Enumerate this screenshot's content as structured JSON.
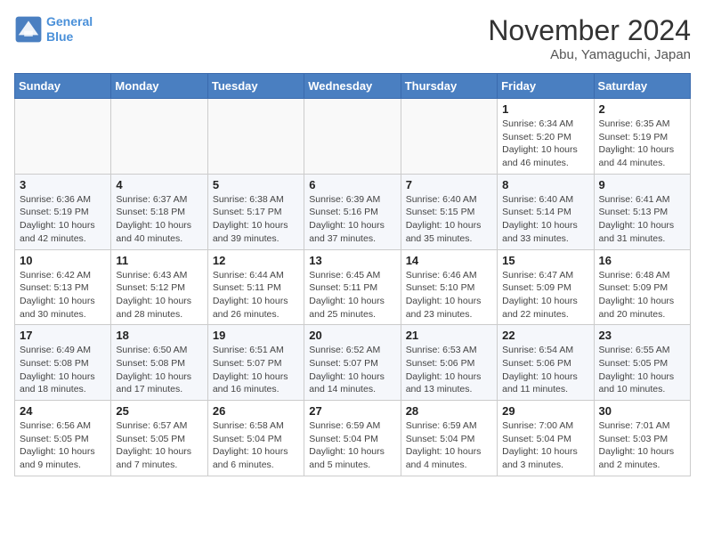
{
  "header": {
    "logo_line1": "General",
    "logo_line2": "Blue",
    "month": "November 2024",
    "location": "Abu, Yamaguchi, Japan"
  },
  "weekdays": [
    "Sunday",
    "Monday",
    "Tuesday",
    "Wednesday",
    "Thursday",
    "Friday",
    "Saturday"
  ],
  "weeks": [
    [
      {
        "day": "",
        "info": ""
      },
      {
        "day": "",
        "info": ""
      },
      {
        "day": "",
        "info": ""
      },
      {
        "day": "",
        "info": ""
      },
      {
        "day": "",
        "info": ""
      },
      {
        "day": "1",
        "info": "Sunrise: 6:34 AM\nSunset: 5:20 PM\nDaylight: 10 hours\nand 46 minutes."
      },
      {
        "day": "2",
        "info": "Sunrise: 6:35 AM\nSunset: 5:19 PM\nDaylight: 10 hours\nand 44 minutes."
      }
    ],
    [
      {
        "day": "3",
        "info": "Sunrise: 6:36 AM\nSunset: 5:19 PM\nDaylight: 10 hours\nand 42 minutes."
      },
      {
        "day": "4",
        "info": "Sunrise: 6:37 AM\nSunset: 5:18 PM\nDaylight: 10 hours\nand 40 minutes."
      },
      {
        "day": "5",
        "info": "Sunrise: 6:38 AM\nSunset: 5:17 PM\nDaylight: 10 hours\nand 39 minutes."
      },
      {
        "day": "6",
        "info": "Sunrise: 6:39 AM\nSunset: 5:16 PM\nDaylight: 10 hours\nand 37 minutes."
      },
      {
        "day": "7",
        "info": "Sunrise: 6:40 AM\nSunset: 5:15 PM\nDaylight: 10 hours\nand 35 minutes."
      },
      {
        "day": "8",
        "info": "Sunrise: 6:40 AM\nSunset: 5:14 PM\nDaylight: 10 hours\nand 33 minutes."
      },
      {
        "day": "9",
        "info": "Sunrise: 6:41 AM\nSunset: 5:13 PM\nDaylight: 10 hours\nand 31 minutes."
      }
    ],
    [
      {
        "day": "10",
        "info": "Sunrise: 6:42 AM\nSunset: 5:13 PM\nDaylight: 10 hours\nand 30 minutes."
      },
      {
        "day": "11",
        "info": "Sunrise: 6:43 AM\nSunset: 5:12 PM\nDaylight: 10 hours\nand 28 minutes."
      },
      {
        "day": "12",
        "info": "Sunrise: 6:44 AM\nSunset: 5:11 PM\nDaylight: 10 hours\nand 26 minutes."
      },
      {
        "day": "13",
        "info": "Sunrise: 6:45 AM\nSunset: 5:11 PM\nDaylight: 10 hours\nand 25 minutes."
      },
      {
        "day": "14",
        "info": "Sunrise: 6:46 AM\nSunset: 5:10 PM\nDaylight: 10 hours\nand 23 minutes."
      },
      {
        "day": "15",
        "info": "Sunrise: 6:47 AM\nSunset: 5:09 PM\nDaylight: 10 hours\nand 22 minutes."
      },
      {
        "day": "16",
        "info": "Sunrise: 6:48 AM\nSunset: 5:09 PM\nDaylight: 10 hours\nand 20 minutes."
      }
    ],
    [
      {
        "day": "17",
        "info": "Sunrise: 6:49 AM\nSunset: 5:08 PM\nDaylight: 10 hours\nand 18 minutes."
      },
      {
        "day": "18",
        "info": "Sunrise: 6:50 AM\nSunset: 5:08 PM\nDaylight: 10 hours\nand 17 minutes."
      },
      {
        "day": "19",
        "info": "Sunrise: 6:51 AM\nSunset: 5:07 PM\nDaylight: 10 hours\nand 16 minutes."
      },
      {
        "day": "20",
        "info": "Sunrise: 6:52 AM\nSunset: 5:07 PM\nDaylight: 10 hours\nand 14 minutes."
      },
      {
        "day": "21",
        "info": "Sunrise: 6:53 AM\nSunset: 5:06 PM\nDaylight: 10 hours\nand 13 minutes."
      },
      {
        "day": "22",
        "info": "Sunrise: 6:54 AM\nSunset: 5:06 PM\nDaylight: 10 hours\nand 11 minutes."
      },
      {
        "day": "23",
        "info": "Sunrise: 6:55 AM\nSunset: 5:05 PM\nDaylight: 10 hours\nand 10 minutes."
      }
    ],
    [
      {
        "day": "24",
        "info": "Sunrise: 6:56 AM\nSunset: 5:05 PM\nDaylight: 10 hours\nand 9 minutes."
      },
      {
        "day": "25",
        "info": "Sunrise: 6:57 AM\nSunset: 5:05 PM\nDaylight: 10 hours\nand 7 minutes."
      },
      {
        "day": "26",
        "info": "Sunrise: 6:58 AM\nSunset: 5:04 PM\nDaylight: 10 hours\nand 6 minutes."
      },
      {
        "day": "27",
        "info": "Sunrise: 6:59 AM\nSunset: 5:04 PM\nDaylight: 10 hours\nand 5 minutes."
      },
      {
        "day": "28",
        "info": "Sunrise: 6:59 AM\nSunset: 5:04 PM\nDaylight: 10 hours\nand 4 minutes."
      },
      {
        "day": "29",
        "info": "Sunrise: 7:00 AM\nSunset: 5:04 PM\nDaylight: 10 hours\nand 3 minutes."
      },
      {
        "day": "30",
        "info": "Sunrise: 7:01 AM\nSunset: 5:03 PM\nDaylight: 10 hours\nand 2 minutes."
      }
    ]
  ]
}
